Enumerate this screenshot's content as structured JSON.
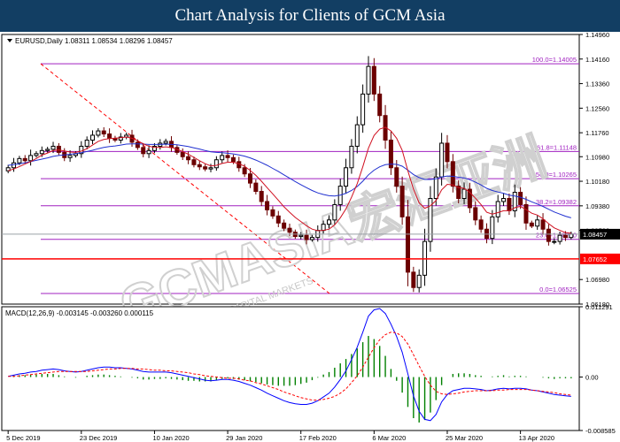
{
  "banner": {
    "title": "Chart Analysis for Clients of GCM Asia"
  },
  "main_panel": {
    "header": "EURUSD,Daily  1.08311 1.08534 1.08296 1.08457",
    "watermark": "GCMASIA宏汇亚洲",
    "watermark_sub": "GLOBAL CAPITAL MARKETS"
  },
  "macd_panel": {
    "header": "MACD(12,26,9) -0.003145 -0.003260 0.000115"
  },
  "colors": {
    "banner": "#123e63",
    "candle_up": "#000000",
    "candle_down": "#6b0000",
    "ma_fast": "#d01020",
    "ma_slow": "#2030d0",
    "fib": "#a020c0",
    "support": "#ff0000",
    "macd_line": "#0000ff",
    "signal_line": "#ff0000",
    "histogram": "#008000"
  },
  "chart_data": [
    {
      "type": "candlestick",
      "symbol": "EURUSD",
      "timeframe": "Daily",
      "ohlc_current": {
        "open": 1.08311,
        "high": 1.08534,
        "low": 1.08296,
        "close": 1.08457
      },
      "x_ticks": [
        "5 Dec 2019",
        "23 Dec 2019",
        "10 Jan 2020",
        "29 Jan 2020",
        "17 Feb 2020",
        "6 Mar 2020",
        "25 Mar 2020",
        "13 Apr 2020"
      ],
      "y_ticks": [
        "1.14960",
        "1.14160",
        "1.13360",
        "1.12560",
        "1.11760",
        "1.10980",
        "1.10180",
        "1.09380",
        "1.08580",
        "1.06980",
        "1.06180"
      ],
      "ylim": [
        1.0618,
        1.1496
      ],
      "fibonacci": [
        {
          "label": "100.0=1.14005",
          "value": 1.14005
        },
        {
          "label": "61.8=1.11148",
          "value": 1.11148
        },
        {
          "label": "50.0=1.10265",
          "value": 1.10265
        },
        {
          "label": "38.2=1.09382",
          "value": 1.09382
        },
        {
          "label": "23.6=1.08290",
          "value": 1.0829
        },
        {
          "label": "0.0=1.06525",
          "value": 1.06525
        }
      ],
      "current_price": {
        "label": "1.08457",
        "value": 1.08457
      },
      "support": {
        "label": "1.07652",
        "value": 1.07652
      },
      "closes": [
        1.1062,
        1.1078,
        1.1092,
        1.1085,
        1.1102,
        1.1108,
        1.1118,
        1.1122,
        1.1132,
        1.1112,
        1.1095,
        1.1102,
        1.1108,
        1.1132,
        1.1152,
        1.1168,
        1.1182,
        1.1172,
        1.1158,
        1.1152,
        1.1162,
        1.1168,
        1.1145,
        1.1128,
        1.1108,
        1.1118,
        1.1132,
        1.1142,
        1.1148,
        1.1128,
        1.1112,
        1.1098,
        1.1088,
        1.1072,
        1.1065,
        1.1058,
        1.1062,
        1.1088,
        1.1102,
        1.1095,
        1.1082,
        1.1062,
        1.1042,
        1.1012,
        1.0985,
        1.0952,
        1.0925,
        1.0905,
        1.0882,
        1.0865,
        1.0852,
        1.0838,
        1.0842,
        1.0828,
        1.0835,
        1.0858,
        1.0878,
        1.0892,
        1.0942,
        1.1002,
        1.1062,
        1.1132,
        1.1202,
        1.1302,
        1.1392,
        1.1302,
        1.1232,
        1.1152,
        1.1062,
        1.1002,
        1.0902,
        1.0722,
        1.0672,
        1.0712,
        1.0822,
        1.0962,
        1.1032,
        1.1142,
        1.1082,
        1.1002,
        1.0962,
        1.0992,
        1.0932,
        1.0892,
        1.0862,
        1.0832,
        1.0902,
        1.0952,
        1.0962,
        1.0922,
        1.0982,
        1.0942,
        1.0882,
        1.0872,
        1.0892,
        1.0862,
        1.0822,
        1.0822,
        1.0842,
        1.0835,
        1.0846
      ],
      "ma_fast": [
        1.1052,
        1.1058,
        1.1066,
        1.1074,
        1.1082,
        1.1092,
        1.1103,
        1.111,
        1.1118,
        1.112,
        1.1117,
        1.1113,
        1.1112,
        1.1116,
        1.1124,
        1.1136,
        1.1148,
        1.1154,
        1.1157,
        1.1158,
        1.116,
        1.1162,
        1.1158,
        1.115,
        1.114,
        1.1132,
        1.1128,
        1.1128,
        1.113,
        1.1128,
        1.1122,
        1.1115,
        1.1106,
        1.1096,
        1.1085,
        1.1075,
        1.1068,
        1.107,
        1.1076,
        1.108,
        1.108,
        1.1075,
        1.1067,
        1.1053,
        1.1037,
        1.1018,
        1.0997,
        1.0977,
        1.0956,
        1.0935,
        1.0917,
        1.09,
        1.0887,
        1.0873,
        1.0862,
        1.0857,
        1.0858,
        1.0862,
        1.0876,
        1.0899,
        1.0928,
        1.0966,
        1.101,
        1.1065,
        1.1126,
        1.1167,
        1.1188,
        1.1194,
        1.1182,
        1.1158,
        1.1119,
        1.1052,
        1.0992,
        1.0948,
        1.093,
        1.0938,
        1.0955,
        1.099,
        1.1008,
        1.1006,
        1.0997,
        1.0995,
        1.0982,
        1.0963,
        1.0942,
        1.0917,
        1.0911,
        1.0916,
        1.0922,
        1.0922,
        1.0932,
        1.0936,
        1.0926,
        1.0914,
        1.0908,
        1.0896,
        1.088,
        1.0866,
        1.0858,
        1.0851,
        1.0849
      ],
      "ma_slow": [
        1.107,
        1.1072,
        1.1075,
        1.1078,
        1.1082,
        1.1086,
        1.109,
        1.1094,
        1.1099,
        1.1102,
        1.1104,
        1.1106,
        1.1108,
        1.1111,
        1.1115,
        1.1119,
        1.1124,
        1.1128,
        1.1131,
        1.1133,
        1.1136,
        1.1139,
        1.114,
        1.114,
        1.1139,
        1.1138,
        1.1138,
        1.1138,
        1.1139,
        1.1138,
        1.1137,
        1.1134,
        1.1131,
        1.1127,
        1.1123,
        1.1118,
        1.1114,
        1.1112,
        1.1111,
        1.1109,
        1.1107,
        1.1104,
        1.11,
        1.1094,
        1.1087,
        1.1079,
        1.107,
        1.106,
        1.105,
        1.1039,
        1.1028,
        1.1017,
        1.1007,
        1.0997,
        1.0988,
        1.098,
        1.0975,
        1.0971,
        1.097,
        1.0973,
        1.0979,
        1.0988,
        1.1001,
        1.1018,
        1.1039,
        1.1054,
        1.1065,
        1.1072,
        1.1074,
        1.1073,
        1.1067,
        1.1054,
        1.104,
        1.103,
        1.1024,
        1.1024,
        1.1026,
        1.1032,
        1.1035,
        1.1034,
        1.1031,
        1.1029,
        1.1023,
        1.1015,
        1.1006,
        1.0995,
        1.0988,
        1.0983,
        1.0979,
        1.0973,
        1.097,
        1.0966,
        1.0959,
        1.0951,
        1.0944,
        1.0936,
        1.0927,
        1.0918,
        1.0911,
        1.0904,
        1.0899
      ]
    },
    {
      "type": "macd",
      "params": "12,26,9",
      "values": {
        "macd": -0.003145,
        "signal": -0.00326,
        "histogram": 0.000115
      },
      "y_ticks": [
        "0.011291",
        "0.00",
        "-0.008585"
      ],
      "ylim": [
        -0.008585,
        0.011291
      ],
      "macd_line": [
        0.0001,
        0.0003,
        0.0005,
        0.0006,
        0.0008,
        0.0009,
        0.0011,
        0.0012,
        0.0013,
        0.0012,
        0.001,
        0.0009,
        0.0008,
        0.0009,
        0.0011,
        0.0013,
        0.0015,
        0.0016,
        0.0016,
        0.0015,
        0.0015,
        0.0014,
        0.0013,
        0.0011,
        0.0009,
        0.0008,
        0.0008,
        0.0008,
        0.0008,
        0.0007,
        0.0005,
        0.0003,
        0.0001,
        -0.0001,
        -0.0003,
        -0.0005,
        -0.0006,
        -0.0005,
        -0.0004,
        -0.0004,
        -0.0005,
        -0.0007,
        -0.001,
        -0.0013,
        -0.0017,
        -0.0021,
        -0.0026,
        -0.003,
        -0.0034,
        -0.0038,
        -0.0041,
        -0.0043,
        -0.0044,
        -0.0044,
        -0.0042,
        -0.0038,
        -0.0032,
        -0.0026,
        -0.0016,
        -0.0004,
        0.001,
        0.0028,
        0.0048,
        0.0072,
        0.0098,
        0.0108,
        0.011,
        0.0102,
        0.0085,
        0.0065,
        0.004,
        0.0005,
        -0.003,
        -0.0055,
        -0.0068,
        -0.007,
        -0.006,
        -0.004,
        -0.0028,
        -0.0022,
        -0.002,
        -0.0018,
        -0.0018,
        -0.0019,
        -0.002,
        -0.0022,
        -0.0021,
        -0.0019,
        -0.0018,
        -0.0019,
        -0.0018,
        -0.0018,
        -0.0019,
        -0.0021,
        -0.0022,
        -0.0024,
        -0.0026,
        -0.0028,
        -0.0029,
        -0.003,
        -0.0031
      ],
      "signal_line": [
        0.0001,
        0.0001,
        0.0002,
        0.0003,
        0.0004,
        0.0005,
        0.0006,
        0.0007,
        0.0008,
        0.0009,
        0.0009,
        0.0009,
        0.0009,
        0.0009,
        0.0009,
        0.001,
        0.0011,
        0.0012,
        0.0013,
        0.0013,
        0.0014,
        0.0014,
        0.0014,
        0.0013,
        0.0013,
        0.0012,
        0.0011,
        0.0011,
        0.001,
        0.001,
        0.0009,
        0.0008,
        0.0007,
        0.0005,
        0.0004,
        0.0002,
        0.0001,
        0.0,
        -0.0001,
        -0.0002,
        -0.0002,
        -0.0003,
        -0.0005,
        -0.0006,
        -0.0009,
        -0.0011,
        -0.0014,
        -0.0017,
        -0.002,
        -0.0024,
        -0.0027,
        -0.003,
        -0.0033,
        -0.0035,
        -0.0037,
        -0.0037,
        -0.0036,
        -0.0034,
        -0.0031,
        -0.0026,
        -0.0019,
        -0.0009,
        0.0002,
        0.0016,
        0.0032,
        0.0047,
        0.006,
        0.0068,
        0.0072,
        0.0071,
        0.0065,
        0.0053,
        0.0036,
        0.0018,
        0.0001,
        -0.0013,
        -0.0023,
        -0.0027,
        -0.0028,
        -0.0027,
        -0.0026,
        -0.0024,
        -0.0023,
        -0.0022,
        -0.0022,
        -0.0022,
        -0.0022,
        -0.0021,
        -0.0021,
        -0.002,
        -0.002,
        -0.002,
        -0.002,
        -0.0021,
        -0.0022,
        -0.0023,
        -0.0024,
        -0.0025,
        -0.0027,
        -0.0028,
        -0.0029
      ]
    }
  ]
}
